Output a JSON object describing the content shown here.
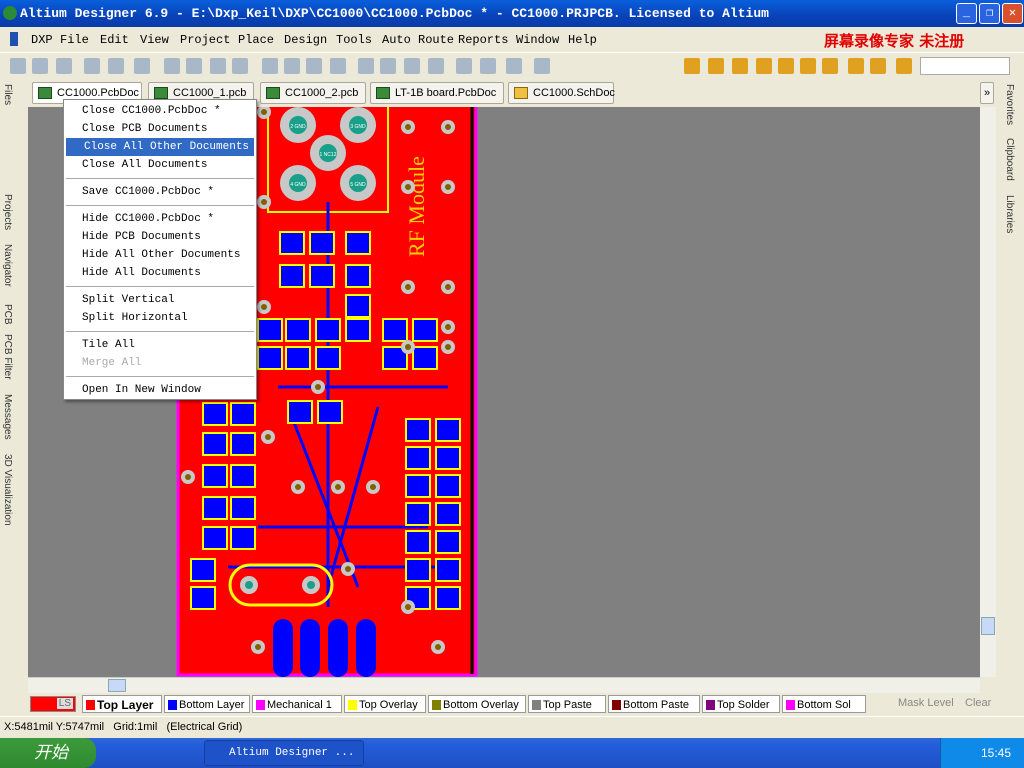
{
  "window": {
    "title": "Altium Designer 6.9 - E:\\Dxp_Keil\\DXP\\CC1000\\CC1000.PcbDoc * - CC1000.PRJPCB. Licensed to Altium"
  },
  "menu": [
    "DXP",
    "File",
    "Edit",
    "View",
    "Project",
    "Place",
    "Design",
    "Tools",
    "Auto Route",
    "Reports",
    "Window",
    "Help"
  ],
  "watermark": "屏幕录像专家 未注册",
  "tabs": [
    "CC1000.PcbDoc *",
    "CC1000_1.pcb *",
    "CC1000_2.pcb *",
    "LT-1B board.PcbDoc *",
    "CC1000.SchDoc"
  ],
  "left_panels": [
    "Files",
    "Projects",
    "Navigator",
    "PCB",
    "PCB Filter",
    "Messages",
    "3D Visualization"
  ],
  "right_panels": [
    "Favorites",
    "Clipboard",
    "Libraries"
  ],
  "context_menu": [
    {
      "label": "Close CC1000.PcbDoc *"
    },
    {
      "label": "Close PCB Documents"
    },
    {
      "label": "Close All Other Documents",
      "selected": true
    },
    {
      "label": "Close All Documents"
    },
    {
      "sep": true
    },
    {
      "label": "Save CC1000.PcbDoc *"
    },
    {
      "sep": true
    },
    {
      "label": "Hide CC1000.PcbDoc *"
    },
    {
      "label": "Hide PCB Documents"
    },
    {
      "label": "Hide All Other Documents"
    },
    {
      "label": "Hide All Documents"
    },
    {
      "sep": true
    },
    {
      "label": "Split Vertical"
    },
    {
      "label": "Split Horizontal"
    },
    {
      "sep": true
    },
    {
      "label": "Tile All"
    },
    {
      "label": "Merge All",
      "disabled": true
    },
    {
      "sep": true
    },
    {
      "label": "Open In New Window"
    }
  ],
  "pcb": {
    "silkscreen_text": "RF Module",
    "pad_labels": [
      "2 GND",
      "3 GND",
      "1 NC12",
      "4 GND",
      "5 GND"
    ]
  },
  "layers": {
    "ls": "LS",
    "items": [
      {
        "name": "Top Layer",
        "color": "#ff0000",
        "active": true
      },
      {
        "name": "Bottom Layer",
        "color": "#0000ff"
      },
      {
        "name": "Mechanical 1",
        "color": "#ff00ff"
      },
      {
        "name": "Top Overlay",
        "color": "#ffff00"
      },
      {
        "name": "Bottom Overlay",
        "color": "#808000"
      },
      {
        "name": "Top Paste",
        "color": "#808080"
      },
      {
        "name": "Bottom Paste",
        "color": "#800000"
      },
      {
        "name": "Top Solder",
        "color": "#800080"
      },
      {
        "name": "Bottom Sol",
        "color": "#ff00ff"
      }
    ],
    "mask_level": "Mask Level",
    "clear": "Clear"
  },
  "status": {
    "coords": "X:5481mil Y:5747mil",
    "grid": "Grid:1mil",
    "grid_type": "(Electrical Grid)"
  },
  "taskbar": {
    "start": "开始",
    "task": "Altium Designer ...",
    "time": "15:45"
  }
}
